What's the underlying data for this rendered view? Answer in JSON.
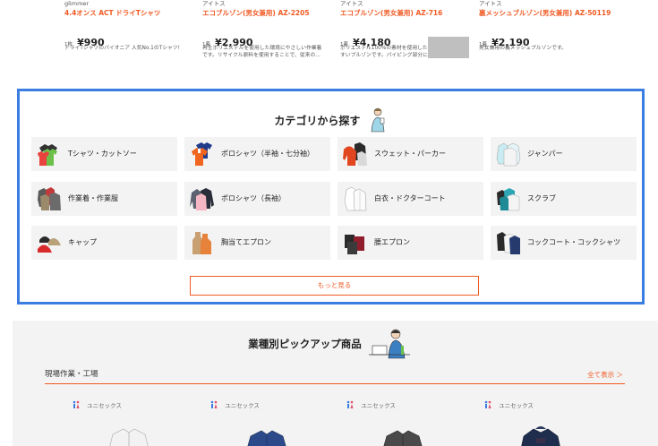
{
  "products": [
    {
      "brand": "glimmer",
      "name": "4.4オンス ACT ドライTシャツ",
      "unit": "1枚",
      "price": "¥990",
      "desc": "ドライTシャツのパイオニア 人気No.1のTシャツ!",
      "desc2": ""
    },
    {
      "brand": "アイトス",
      "name": "エコブルゾン(男女兼用) AZ-2205",
      "unit": "1着",
      "price": "¥2,990",
      "desc": "再生ポリエステルを使用した環境にやさしい作業着",
      "desc2": "です。リサイクル原料を使用することで、従来の…"
    },
    {
      "brand": "アイトス",
      "name": "エコブルゾン(男女兼用) AZ-716",
      "unit": "1着",
      "price": "¥4,180",
      "desc": "ポリエステル100%の素材を使用した",
      "desc2": "すいブルゾンです。パイピング部分に反射材を使…"
    },
    {
      "brand": "アイトス",
      "name": "裏メッシュブルゾン(男女兼用) AZ-50119",
      "unit": "1着",
      "price": "¥2,190",
      "desc": "男女兼用の裏メッシュブルゾンです。",
      "desc2": ""
    }
  ],
  "categories": {
    "title": "カテゴリから探す",
    "items": [
      {
        "label": "Tシャツ・カットソー",
        "icon": "tshirt-icon"
      },
      {
        "label": "ポロシャツ（半袖・七分袖）",
        "icon": "polo-shirt-icon"
      },
      {
        "label": "スウェット・パーカー",
        "icon": "sweat-hoodie-icon"
      },
      {
        "label": "ジャンパー",
        "icon": "jumper-icon"
      },
      {
        "label": "作業着・作業服",
        "icon": "work-clothes-icon"
      },
      {
        "label": "ポロシャツ（長袖）",
        "icon": "long-sleeve-polo-icon"
      },
      {
        "label": "白衣・ドクターコート",
        "icon": "doctor-coat-icon"
      },
      {
        "label": "スクラブ",
        "icon": "scrub-icon"
      },
      {
        "label": "キャップ",
        "icon": "cap-icon"
      },
      {
        "label": "胸当てエプロン",
        "icon": "bib-apron-icon"
      },
      {
        "label": "腰エプロン",
        "icon": "waist-apron-icon"
      },
      {
        "label": "コックコート・コックシャツ",
        "icon": "cook-coat-icon"
      }
    ],
    "more_label": "もっと見る"
  },
  "pickup": {
    "title": "業種別ピックアップ商品",
    "field_label": "現場作業・工場",
    "see_all": "全て表示 ＞",
    "cards": [
      {
        "unisex": "ユニセックス"
      },
      {
        "unisex": "ユニセックス"
      },
      {
        "unisex": "ユニセックス"
      },
      {
        "unisex": "ユニセックス"
      }
    ]
  },
  "colors": {
    "accent": "#f05a23",
    "frame": "#3b7de0",
    "tile": "#f3f3f3"
  }
}
